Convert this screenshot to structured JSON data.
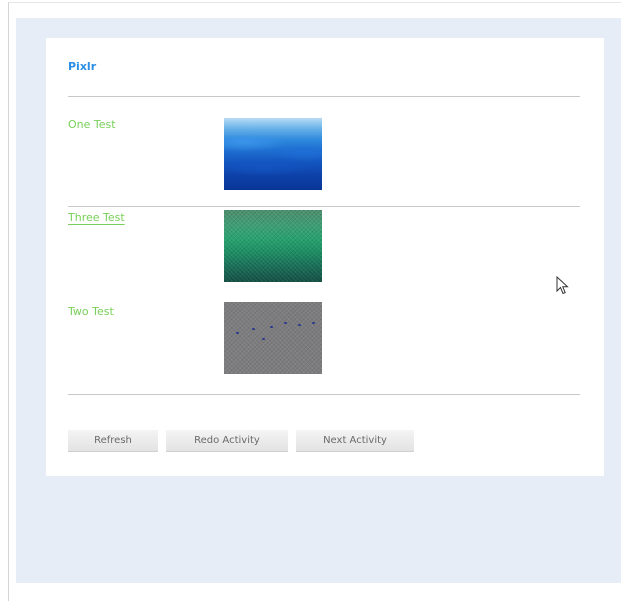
{
  "app": {
    "title": "Pixlr"
  },
  "rows": [
    {
      "label": "One Test",
      "thumbnail": "blue-gradient-image",
      "active": false
    },
    {
      "label": "Three Test",
      "thumbnail": "green-noise-image",
      "active": true
    },
    {
      "label": "Two Test",
      "thumbnail": "gray-noise-image",
      "active": false
    }
  ],
  "buttons": {
    "refresh": "Refresh",
    "redo": "Redo Activity",
    "next": "Next Activity"
  },
  "colors": {
    "title": "#2b8fe6",
    "row_label": "#78d05a",
    "page_background": "#e7edf6",
    "card_background": "#ffffff"
  }
}
